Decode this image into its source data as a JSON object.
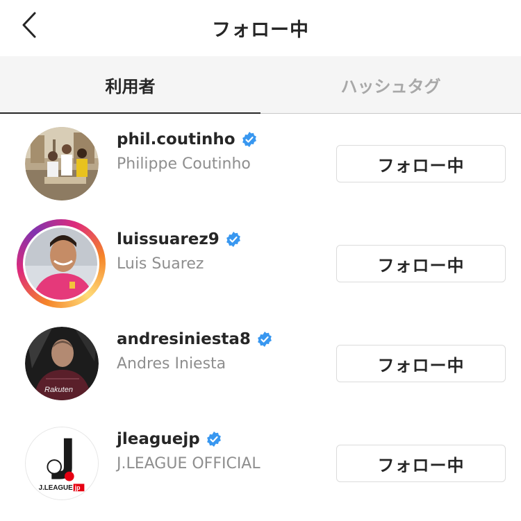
{
  "header": {
    "title": "フォロー中",
    "back_icon": "chevron-left-icon"
  },
  "tabs": [
    {
      "label": "利用者",
      "active": true
    },
    {
      "label": "ハッシュタグ",
      "active": false
    }
  ],
  "following": [
    {
      "username": "phil.coutinho",
      "full_name": "Philippe Coutinho",
      "verified": true,
      "story_ring": false,
      "button_label": "フォロー中"
    },
    {
      "username": "luissuarez9",
      "full_name": "Luis Suarez",
      "verified": true,
      "story_ring": true,
      "button_label": "フォロー中"
    },
    {
      "username": "andresiniesta8",
      "full_name": "Andres Iniesta",
      "verified": true,
      "story_ring": false,
      "button_label": "フォロー中",
      "avatar_text": "Rakuten"
    },
    {
      "username": "jleaguejp",
      "full_name": "J.LEAGUE OFFICIAL",
      "verified": true,
      "story_ring": false,
      "button_label": "フォロー中",
      "avatar_text": "J.LEAGUE",
      "avatar_badge": "jp"
    }
  ],
  "colors": {
    "verified_blue": "#3897f0",
    "muted_text": "#8e8e8e",
    "primary_text": "#262626",
    "tab_bg": "#f5f5f5",
    "border": "#dbdbdb"
  }
}
